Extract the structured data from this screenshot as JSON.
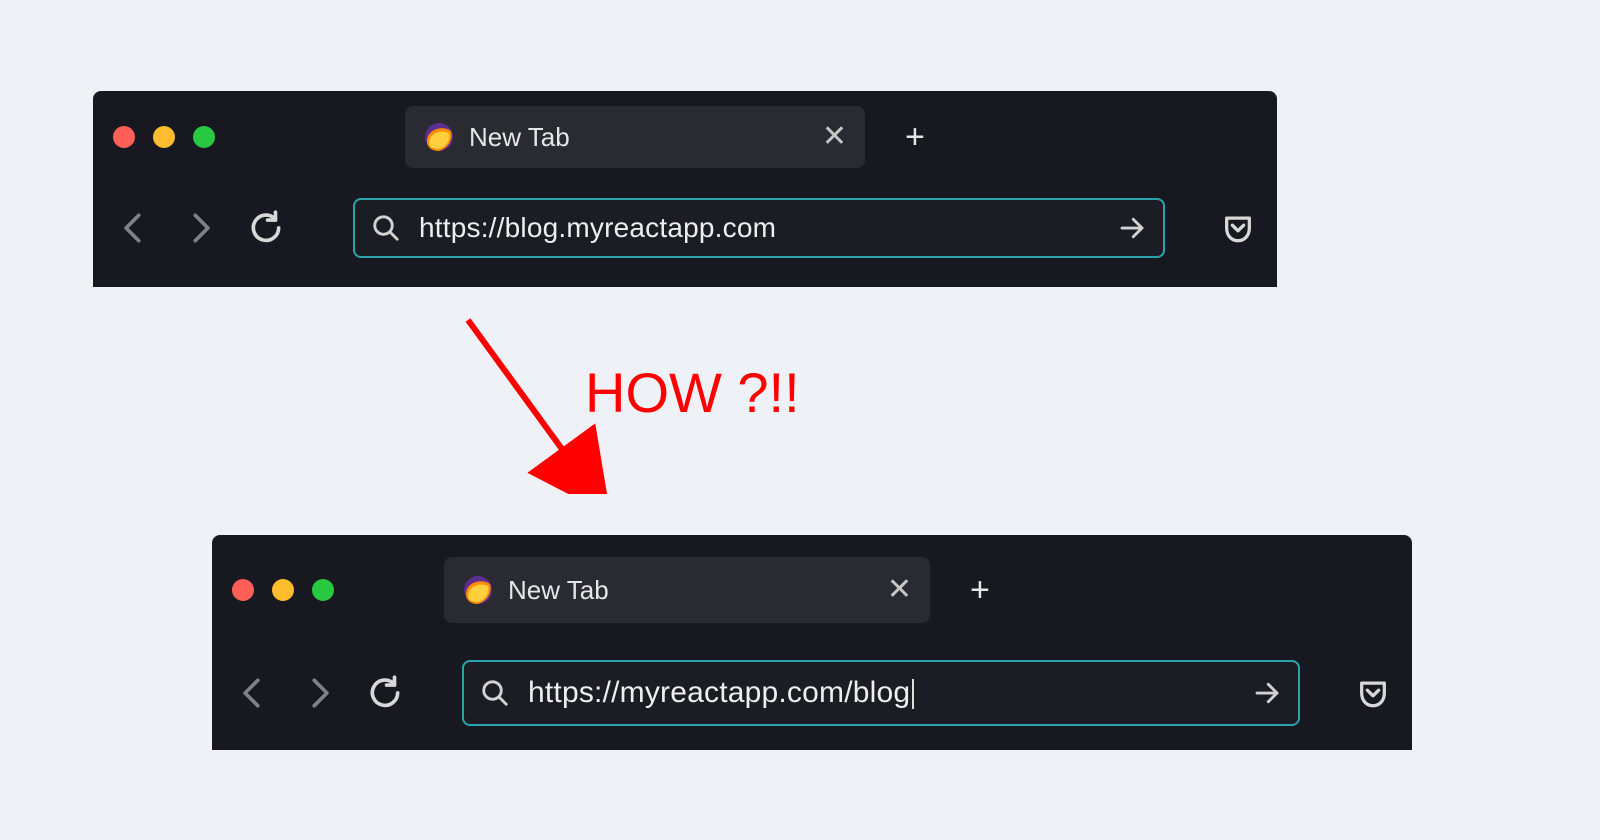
{
  "annotation": {
    "text": "HOW ?!!"
  },
  "colors": {
    "accent": "#2aa4aa",
    "annotation": "#ff0000"
  },
  "windows": [
    {
      "tab_title": "New Tab",
      "url": "https://blog.myreactapp.com",
      "show_cursor": false
    },
    {
      "tab_title": "New Tab",
      "url": "https://myreactapp.com/blog",
      "show_cursor": true
    }
  ]
}
